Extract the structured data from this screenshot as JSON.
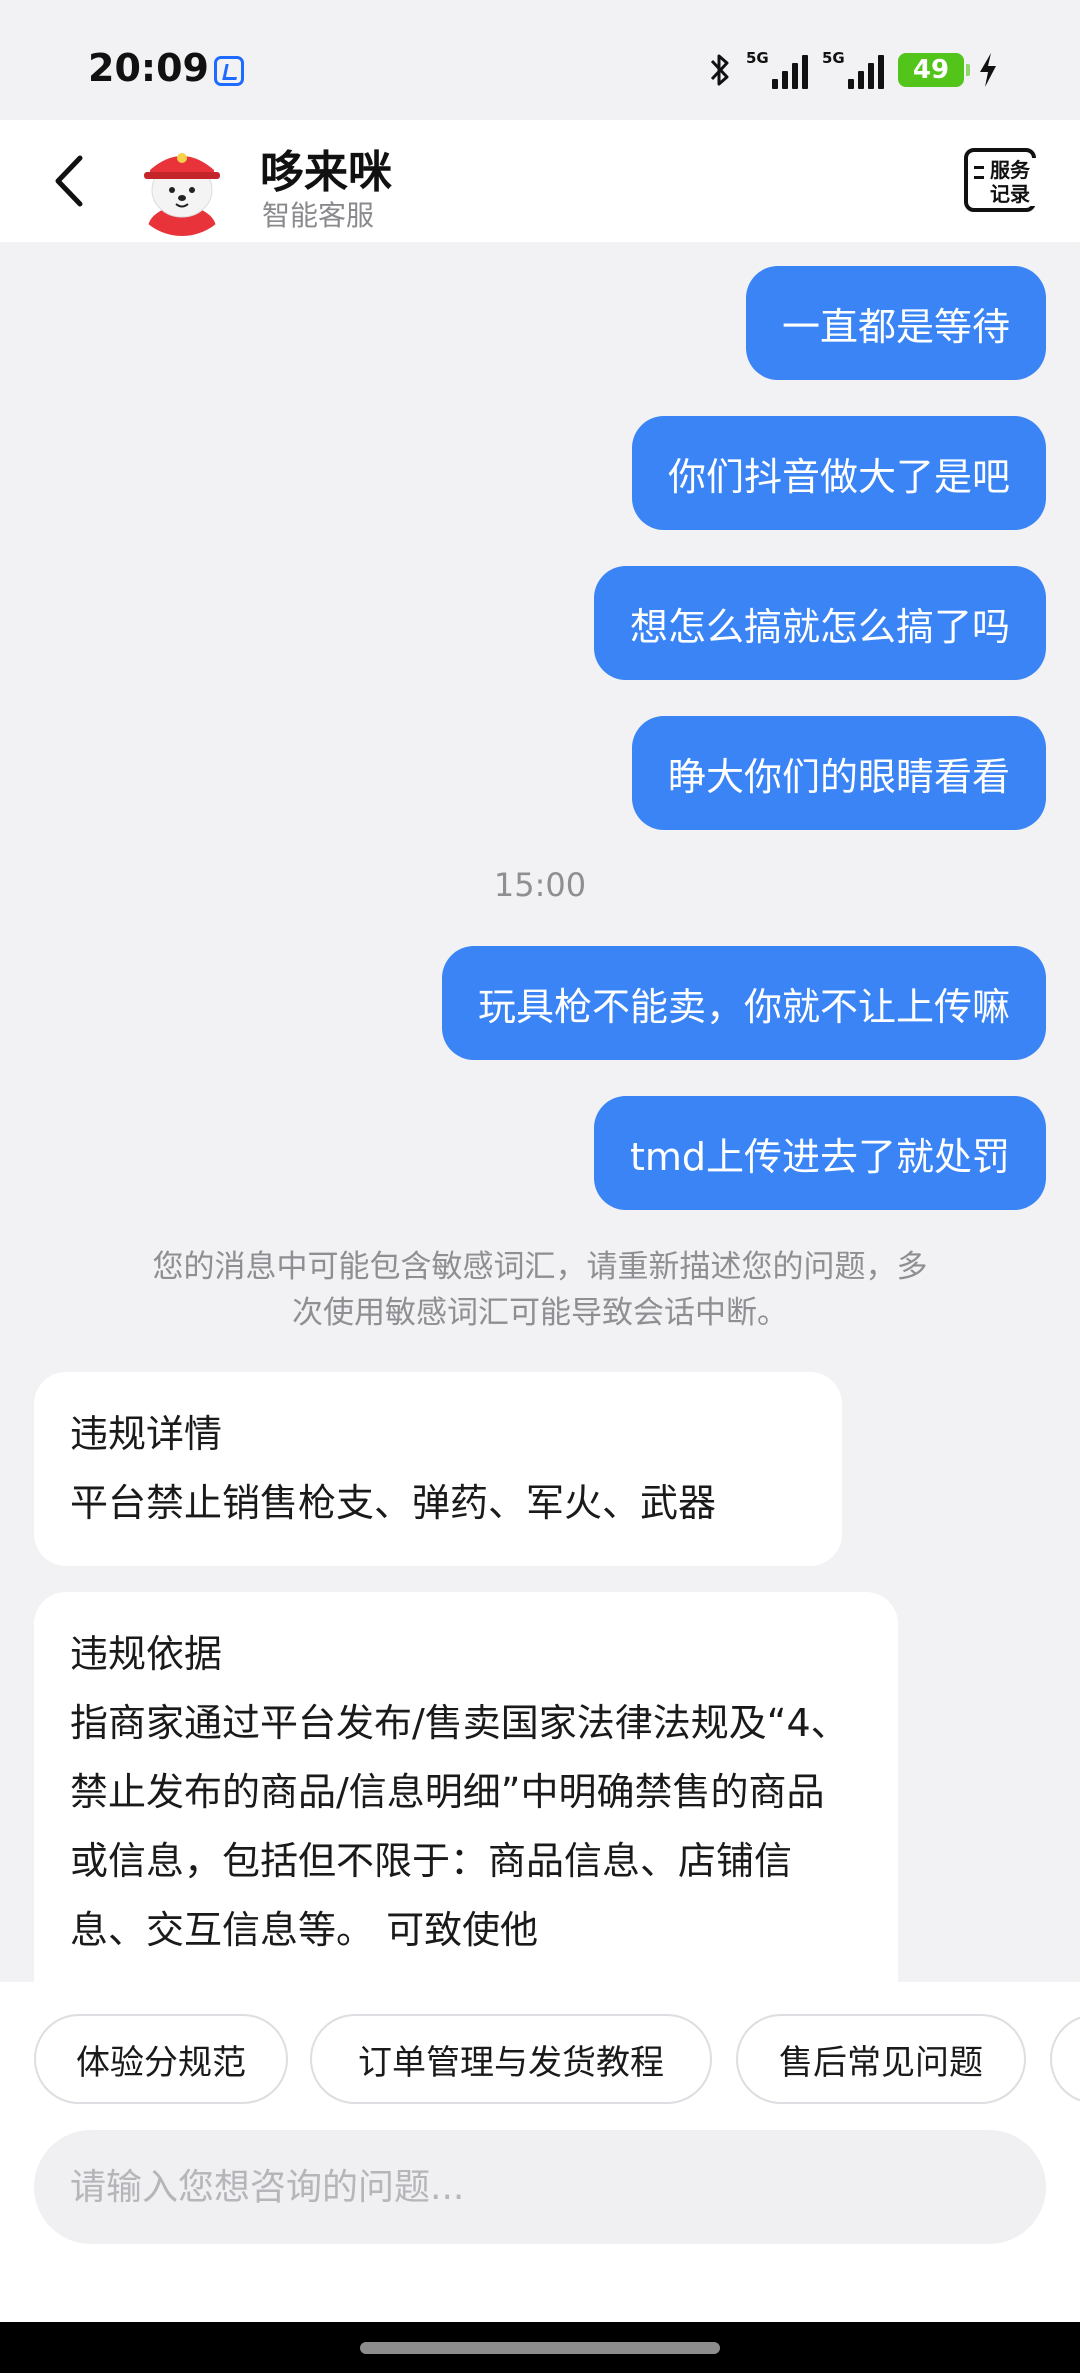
{
  "status_bar": {
    "time": "20:09",
    "network_1": "5G",
    "network_2": "5G",
    "battery": "49",
    "icons": [
      "app-notification-icon",
      "bluetooth-icon",
      "signal-icon",
      "signal-icon",
      "battery-icon",
      "charging-icon"
    ]
  },
  "header": {
    "title": "哆来咪",
    "subtitle": "智能客服",
    "service_record_label": "服务记录",
    "icons": [
      "back-arrow-icon",
      "service-record-icon"
    ]
  },
  "messages": [
    {
      "from": "user",
      "text": "一直都是等待"
    },
    {
      "from": "user",
      "text": "你们抖音做大了是吧"
    },
    {
      "from": "user",
      "text": "想怎么搞就怎么搞了吗"
    },
    {
      "from": "user",
      "text": "睁大你们的眼睛看看"
    },
    {
      "timestamp": "15:00"
    },
    {
      "from": "user",
      "text": "玩具枪不能卖，你就不让上传嘛"
    },
    {
      "from": "user",
      "text": "tmd上传进去了就处罚"
    },
    {
      "system": "您的消息中可能包含敏感词汇，请重新描述您的问题，多次使用敏感词汇可能导致会话中断。"
    },
    {
      "from": "bot",
      "title": "违规详情",
      "text": "平台禁止销售枪支、弹药、军火、武器"
    },
    {
      "from": "bot",
      "title": "违规依据",
      "text": "指商家通过平台发布/售卖国家法律法规及“4、禁止发布的商品/信息明细”中明确禁售的商品或信息，包括但不限于：商品信息、店铺信息、交互信息等。 可致使他"
    }
  ],
  "quick_replies": [
    "体验分规范",
    "订单管理与发货教程",
    "售后常见问题"
  ],
  "input": {
    "placeholder": "请输入您想咨询的问题..."
  },
  "colors": {
    "user_bubble": "#3a84f5",
    "background": "#f2f2f4",
    "battery": "#52c41a"
  }
}
